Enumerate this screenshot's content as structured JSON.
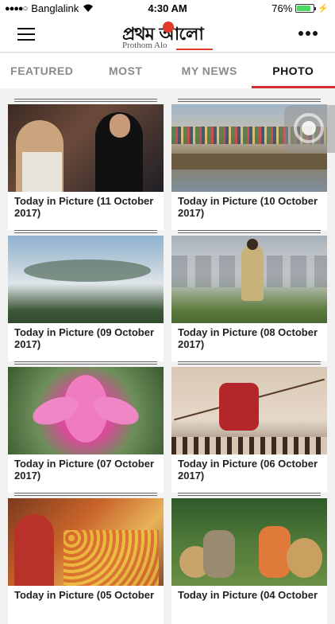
{
  "status": {
    "carrier": "Banglalink",
    "time": "4:30 AM",
    "battery": "76%",
    "battery_level": 0.76
  },
  "header": {
    "logo_bn": "প্রথম আলো",
    "logo_en": "Prothom Alo"
  },
  "tabs": [
    {
      "label": "FEATURED"
    },
    {
      "label": "MOST"
    },
    {
      "label": "MY NEWS"
    },
    {
      "label": "PHOTO"
    }
  ],
  "photos": [
    {
      "caption": "Today in Picture (11 October 2017)"
    },
    {
      "caption": "Today in Picture (10 October 2017)"
    },
    {
      "caption": "Today in Picture (09 October 2017)"
    },
    {
      "caption": "Today in Picture (08 October 2017)"
    },
    {
      "caption": "Today in Picture (07 October 2017)"
    },
    {
      "caption": "Today in Picture (06 October 2017)"
    },
    {
      "caption": "Today in Picture (05 October"
    },
    {
      "caption": "Today in Picture (04 October"
    }
  ]
}
